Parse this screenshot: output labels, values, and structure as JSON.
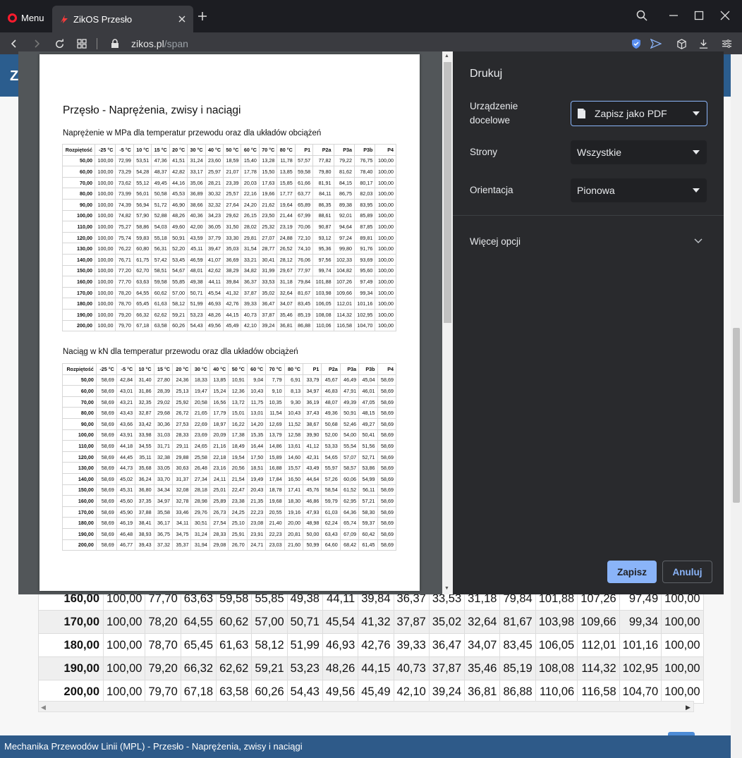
{
  "browser": {
    "menu_label": "Menu",
    "tab_title": "ZikOS Przesło",
    "address_host": "zikos.pl",
    "address_path": "/span"
  },
  "site": {
    "header_letter": "Z",
    "footer_text": "Mechanika Przewodów Linii (MPL) - Przesło - Naprężenia, zwisy i naciągi",
    "background_table_rows": [
      [
        "160,00",
        "100,00",
        "77,70",
        "63,63",
        "59,58",
        "55,85",
        "49,38",
        "44,11",
        "39,84",
        "36,37",
        "33,53",
        "31,18",
        "79,84",
        "101,88",
        "107,26",
        "97,49",
        "100,00"
      ],
      [
        "170,00",
        "100,00",
        "78,20",
        "64,55",
        "60,62",
        "57,00",
        "50,71",
        "45,54",
        "41,32",
        "37,87",
        "35,02",
        "32,64",
        "81,67",
        "103,98",
        "109,66",
        "99,34",
        "100,00"
      ],
      [
        "180,00",
        "100,00",
        "78,70",
        "65,45",
        "61,63",
        "58,12",
        "51,99",
        "46,93",
        "42,76",
        "39,33",
        "36,47",
        "34,07",
        "83,45",
        "106,05",
        "112,01",
        "101,16",
        "100,00"
      ],
      [
        "190,00",
        "100,00",
        "79,20",
        "66,32",
        "62,62",
        "59,21",
        "53,23",
        "48,26",
        "44,15",
        "40,73",
        "37,87",
        "35,46",
        "85,19",
        "108,08",
        "114,32",
        "102,95",
        "100,00"
      ],
      [
        "200,00",
        "100,00",
        "79,70",
        "67,18",
        "63,58",
        "60,26",
        "54,43",
        "49,56",
        "45,49",
        "42,10",
        "39,24",
        "36,81",
        "86,88",
        "110,06",
        "116,58",
        "104,70",
        "100,00"
      ]
    ]
  },
  "print_dialog": {
    "title": "Drukuj",
    "destination_label": "Urządzenie docelowe",
    "destination_value": "Zapisz jako PDF",
    "pages_label": "Strony",
    "pages_value": "Wszystkie",
    "orientation_label": "Orientacja",
    "orientation_value": "Pionowa",
    "more_options_label": "Więcej opcji",
    "save_label": "Zapisz",
    "cancel_label": "Anuluj"
  },
  "preview": {
    "doc_title": "Przęsło - Naprężenia, zwisy i naciągi",
    "section1_title": "Naprężenie w MPa dla temperatur przewodu oraz dla układów obciążeń",
    "section2_title": "Naciąg w kN dla temperatur przewodu oraz dla układów obciążeń",
    "headers": [
      "Rozpiętość",
      "-25 °C",
      "-5 °C",
      "10 °C",
      "15 °C",
      "20 °C",
      "30 °C",
      "40 °C",
      "50 °C",
      "60 °C",
      "70 °C",
      "80 °C",
      "P1",
      "P2a",
      "P3a",
      "P3b",
      "P4"
    ],
    "table1_rows": [
      [
        "50,00",
        "100,00",
        "72,99",
        "53,51",
        "47,36",
        "41,51",
        "31,24",
        "23,60",
        "18,59",
        "15,40",
        "13,28",
        "11,78",
        "57,57",
        "77,82",
        "79,22",
        "76,75",
        "100,00"
      ],
      [
        "60,00",
        "100,00",
        "73,29",
        "54,28",
        "48,37",
        "42,82",
        "33,17",
        "25,97",
        "21,07",
        "17,78",
        "15,50",
        "13,85",
        "59,58",
        "79,80",
        "81,62",
        "78,40",
        "100,00"
      ],
      [
        "70,00",
        "100,00",
        "73,62",
        "55,12",
        "49,45",
        "44,16",
        "35,06",
        "28,21",
        "23,39",
        "20,03",
        "17,63",
        "15,85",
        "61,66",
        "81,91",
        "84,15",
        "80,17",
        "100,00"
      ],
      [
        "80,00",
        "100,00",
        "73,99",
        "56,01",
        "50,58",
        "45,53",
        "36,89",
        "30,32",
        "25,57",
        "22,16",
        "19,66",
        "17,77",
        "63,77",
        "84,11",
        "86,75",
        "82,03",
        "100,00"
      ],
      [
        "90,00",
        "100,00",
        "74,39",
        "56,94",
        "51,72",
        "46,90",
        "38,66",
        "32,32",
        "27,64",
        "24,20",
        "21,62",
        "19,64",
        "65,89",
        "86,35",
        "89,38",
        "83,95",
        "100,00"
      ],
      [
        "100,00",
        "100,00",
        "74,82",
        "57,90",
        "52,88",
        "48,26",
        "40,36",
        "34,23",
        "29,62",
        "26,15",
        "23,50",
        "21,44",
        "67,99",
        "88,61",
        "92,01",
        "85,89",
        "100,00"
      ],
      [
        "110,00",
        "100,00",
        "75,27",
        "58,86",
        "54,03",
        "49,60",
        "42,00",
        "36,05",
        "31,50",
        "28,02",
        "25,32",
        "23,19",
        "70,06",
        "90,87",
        "94,64",
        "87,85",
        "100,00"
      ],
      [
        "120,00",
        "100,00",
        "75,74",
        "59,83",
        "55,18",
        "50,91",
        "43,59",
        "37,79",
        "33,30",
        "29,81",
        "27,07",
        "24,88",
        "72,10",
        "93,12",
        "97,24",
        "89,81",
        "100,00"
      ],
      [
        "130,00",
        "100,00",
        "76,22",
        "60,80",
        "56,31",
        "52,20",
        "45,11",
        "39,47",
        "35,03",
        "31,54",
        "28,77",
        "26,52",
        "74,10",
        "95,36",
        "99,80",
        "91,76",
        "100,00"
      ],
      [
        "140,00",
        "100,00",
        "76,71",
        "61,75",
        "57,42",
        "53,45",
        "46,59",
        "41,07",
        "36,69",
        "33,21",
        "30,41",
        "28,12",
        "76,06",
        "97,56",
        "102,33",
        "93,69",
        "100,00"
      ],
      [
        "150,00",
        "100,00",
        "77,20",
        "62,70",
        "58,51",
        "54,67",
        "48,01",
        "42,62",
        "38,29",
        "34,82",
        "31,99",
        "29,67",
        "77,97",
        "99,74",
        "104,82",
        "95,60",
        "100,00"
      ],
      [
        "160,00",
        "100,00",
        "77,70",
        "63,63",
        "59,58",
        "55,85",
        "49,38",
        "44,11",
        "39,84",
        "36,37",
        "33,53",
        "31,18",
        "79,84",
        "101,88",
        "107,26",
        "97,49",
        "100,00"
      ],
      [
        "170,00",
        "100,00",
        "78,20",
        "64,55",
        "60,62",
        "57,00",
        "50,71",
        "45,54",
        "41,32",
        "37,87",
        "35,02",
        "32,64",
        "81,67",
        "103,98",
        "109,66",
        "99,34",
        "100,00"
      ],
      [
        "180,00",
        "100,00",
        "78,70",
        "65,45",
        "61,63",
        "58,12",
        "51,99",
        "46,93",
        "42,76",
        "39,33",
        "36,47",
        "34,07",
        "83,45",
        "106,05",
        "112,01",
        "101,16",
        "100,00"
      ],
      [
        "190,00",
        "100,00",
        "79,20",
        "66,32",
        "62,62",
        "59,21",
        "53,23",
        "48,26",
        "44,15",
        "40,73",
        "37,87",
        "35,46",
        "85,19",
        "108,08",
        "114,32",
        "102,95",
        "100,00"
      ],
      [
        "200,00",
        "100,00",
        "79,70",
        "67,18",
        "63,58",
        "60,26",
        "54,43",
        "49,56",
        "45,49",
        "42,10",
        "39,24",
        "36,81",
        "86,88",
        "110,06",
        "116,58",
        "104,70",
        "100,00"
      ]
    ],
    "table2_rows": [
      [
        "50,00",
        "58,69",
        "42,84",
        "31,40",
        "27,80",
        "24,36",
        "18,33",
        "13,85",
        "10,91",
        "9,04",
        "7,79",
        "6,91",
        "33,79",
        "45,67",
        "46,49",
        "45,04",
        "58,69"
      ],
      [
        "60,00",
        "58,69",
        "43,01",
        "31,86",
        "28,39",
        "25,13",
        "19,47",
        "15,24",
        "12,36",
        "10,43",
        "9,10",
        "8,13",
        "34,97",
        "46,83",
        "47,91",
        "46,01",
        "58,69"
      ],
      [
        "70,00",
        "58,69",
        "43,21",
        "32,35",
        "29,02",
        "25,92",
        "20,58",
        "16,56",
        "13,72",
        "11,75",
        "10,35",
        "9,30",
        "36,19",
        "48,07",
        "49,39",
        "47,05",
        "58,69"
      ],
      [
        "80,00",
        "58,69",
        "43,43",
        "32,87",
        "29,68",
        "26,72",
        "21,65",
        "17,79",
        "15,01",
        "13,01",
        "11,54",
        "10,43",
        "37,43",
        "49,36",
        "50,91",
        "48,15",
        "58,69"
      ],
      [
        "90,00",
        "58,69",
        "43,66",
        "33,42",
        "30,36",
        "27,53",
        "22,69",
        "18,97",
        "16,22",
        "14,20",
        "12,69",
        "11,52",
        "38,67",
        "50,68",
        "52,46",
        "49,27",
        "58,69"
      ],
      [
        "100,00",
        "58,69",
        "43,91",
        "33,98",
        "31,03",
        "28,33",
        "23,69",
        "20,09",
        "17,38",
        "15,35",
        "13,79",
        "12,58",
        "39,90",
        "52,00",
        "54,00",
        "50,41",
        "58,69"
      ],
      [
        "110,00",
        "58,69",
        "44,18",
        "34,55",
        "31,71",
        "29,11",
        "24,65",
        "21,16",
        "18,49",
        "16,44",
        "14,86",
        "13,61",
        "41,12",
        "53,33",
        "55,54",
        "51,56",
        "58,69"
      ],
      [
        "120,00",
        "58,69",
        "44,45",
        "35,11",
        "32,38",
        "29,88",
        "25,58",
        "22,18",
        "19,54",
        "17,50",
        "15,89",
        "14,60",
        "42,31",
        "54,65",
        "57,07",
        "52,71",
        "58,69"
      ],
      [
        "130,00",
        "58,69",
        "44,73",
        "35,68",
        "33,05",
        "30,63",
        "26,48",
        "23,16",
        "20,56",
        "18,51",
        "16,88",
        "15,57",
        "43,49",
        "55,97",
        "58,57",
        "53,86",
        "58,69"
      ],
      [
        "140,00",
        "58,69",
        "45,02",
        "36,24",
        "33,70",
        "31,37",
        "27,34",
        "24,11",
        "21,54",
        "19,49",
        "17,84",
        "16,50",
        "44,64",
        "57,26",
        "60,06",
        "54,99",
        "58,69"
      ],
      [
        "150,00",
        "58,69",
        "45,31",
        "36,80",
        "34,34",
        "32,08",
        "28,18",
        "25,01",
        "22,47",
        "20,43",
        "18,78",
        "17,41",
        "45,76",
        "58,54",
        "61,52",
        "56,11",
        "58,69"
      ],
      [
        "160,00",
        "58,69",
        "45,60",
        "37,35",
        "34,97",
        "32,78",
        "28,98",
        "25,89",
        "23,38",
        "21,35",
        "19,68",
        "18,30",
        "46,86",
        "59,79",
        "62,95",
        "57,21",
        "58,69"
      ],
      [
        "170,00",
        "58,69",
        "45,90",
        "37,88",
        "35,58",
        "33,46",
        "29,76",
        "26,73",
        "24,25",
        "22,23",
        "20,55",
        "19,16",
        "47,93",
        "61,03",
        "64,36",
        "58,30",
        "58,69"
      ],
      [
        "180,00",
        "58,69",
        "46,19",
        "38,41",
        "36,17",
        "34,11",
        "30,51",
        "27,54",
        "25,10",
        "23,08",
        "21,40",
        "20,00",
        "48,98",
        "62,24",
        "65,74",
        "59,37",
        "58,69"
      ],
      [
        "190,00",
        "58,69",
        "46,48",
        "38,93",
        "36,75",
        "34,75",
        "31,24",
        "28,33",
        "25,91",
        "23,91",
        "22,23",
        "20,81",
        "50,00",
        "63,43",
        "67,09",
        "60,42",
        "58,69"
      ],
      [
        "200,00",
        "58,69",
        "46,77",
        "39,43",
        "37,32",
        "35,37",
        "31,94",
        "29,08",
        "26,70",
        "24,71",
        "23,03",
        "21,60",
        "50,99",
        "64,60",
        "68,42",
        "61,45",
        "58,69"
      ]
    ]
  },
  "colors": {
    "accent": "#8ab4f8",
    "dialog_bg": "#292a2d",
    "site_header": "#2b5d8e",
    "footer": "#2e5a89"
  }
}
